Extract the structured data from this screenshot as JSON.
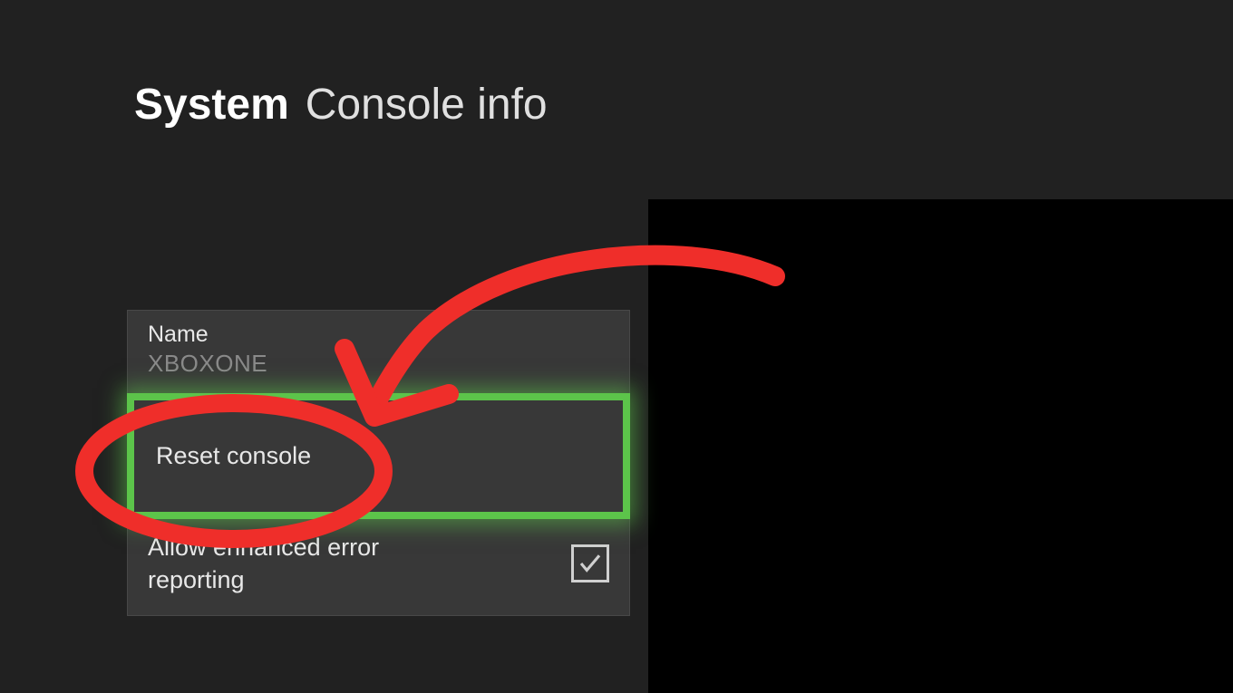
{
  "header": {
    "category": "System",
    "page": "Console info"
  },
  "menu": {
    "name": {
      "label": "Name",
      "value": "XBOXONE"
    },
    "reset": {
      "label": "Reset console"
    },
    "reporting": {
      "label": "Allow enhanced error reporting",
      "checked": true
    }
  },
  "colors": {
    "accent": "#5cc44a",
    "annotation": "#ef2e2a"
  }
}
